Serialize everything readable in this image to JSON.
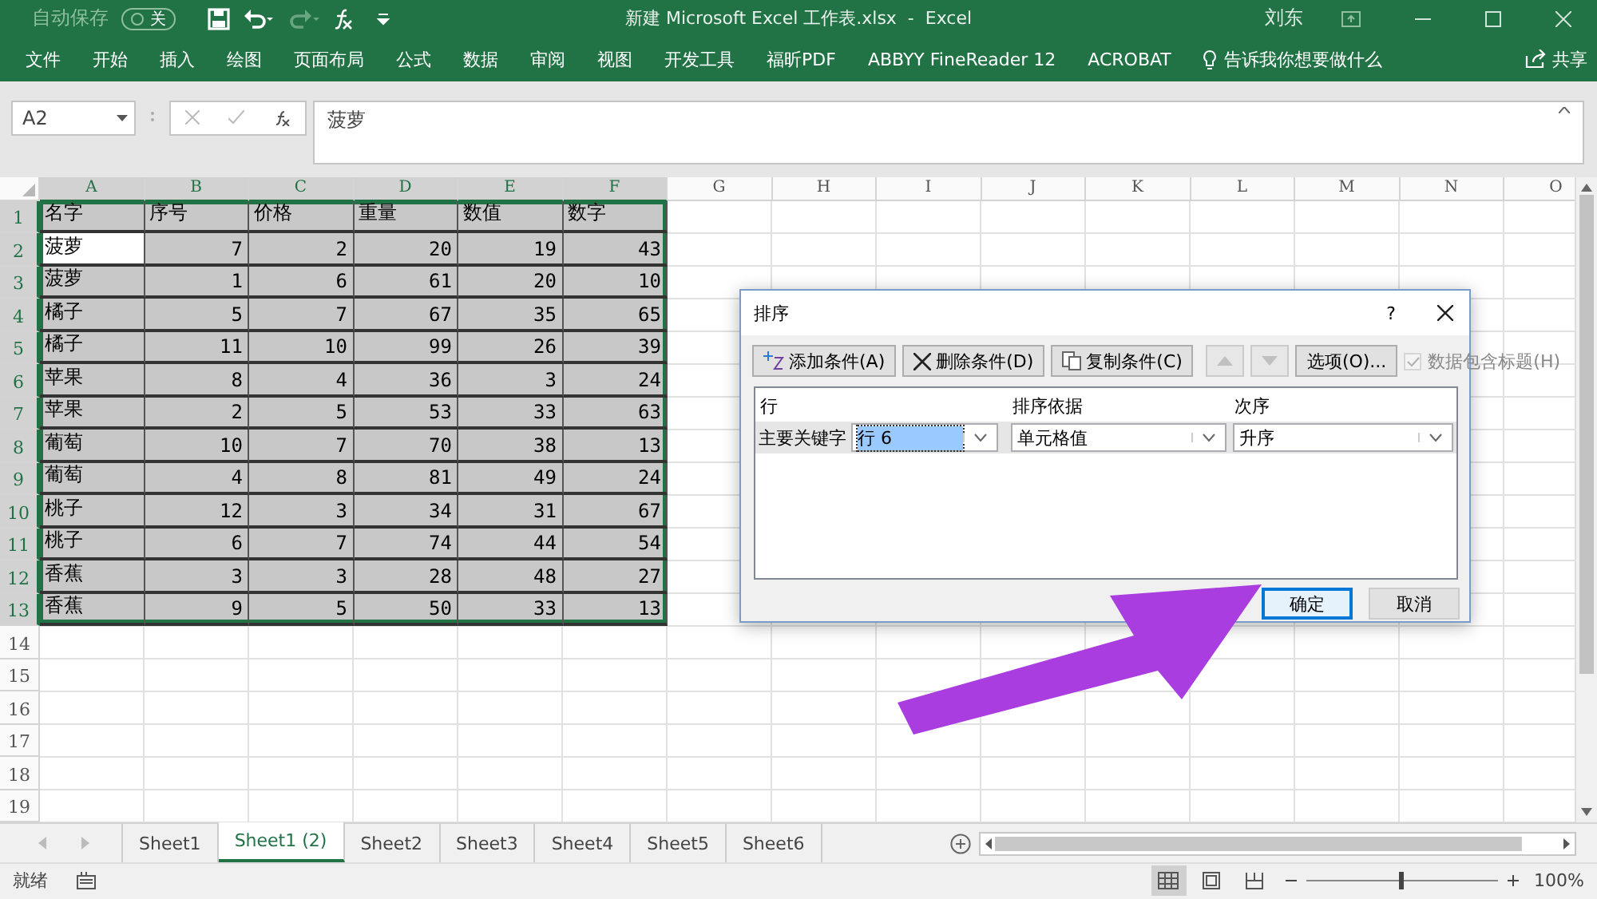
{
  "title_bar": {
    "autosave_label": "自动保存",
    "autosave_state": "关",
    "autosave_on": false,
    "title": "新建 Microsoft Excel 工作表.xlsx  -  Excel",
    "user": "刘东"
  },
  "ribbon": {
    "tabs": [
      "文件",
      "开始",
      "插入",
      "绘图",
      "页面布局",
      "公式",
      "数据",
      "审阅",
      "视图",
      "开发工具",
      "福昕PDF",
      "ABBYY FineReader 12",
      "ACROBAT"
    ],
    "tell_me": "告诉我你想要做什么",
    "share": "共享"
  },
  "formula_bar": {
    "name_box": "A2",
    "formula": "菠萝"
  },
  "sheet": {
    "columns": [
      {
        "label": "A",
        "selected": true
      },
      {
        "label": "B",
        "selected": true
      },
      {
        "label": "C",
        "selected": true
      },
      {
        "label": "D",
        "selected": true
      },
      {
        "label": "E",
        "selected": true
      },
      {
        "label": "F",
        "selected": true
      },
      {
        "label": "G",
        "selected": false
      },
      {
        "label": "H",
        "selected": false
      },
      {
        "label": "I",
        "selected": false
      },
      {
        "label": "J",
        "selected": false
      },
      {
        "label": "K",
        "selected": false
      },
      {
        "label": "L",
        "selected": false
      },
      {
        "label": "M",
        "selected": false
      },
      {
        "label": "N",
        "selected": false
      },
      {
        "label": "O",
        "selected": false
      }
    ],
    "rows": [
      {
        "header": "1",
        "selected": true,
        "cells": [
          "名字",
          "序号",
          "价格",
          "重量",
          "数值",
          "数字"
        ]
      },
      {
        "header": "2",
        "selected": true,
        "cells": [
          {
            "text": "菠萝",
            "active": true
          },
          "7",
          "2",
          "20",
          "19",
          "43"
        ]
      },
      {
        "header": "3",
        "selected": true,
        "cells": [
          "菠萝",
          "1",
          "6",
          "61",
          "20",
          "10"
        ]
      },
      {
        "header": "4",
        "selected": true,
        "cells": [
          "橘子",
          "5",
          "7",
          "67",
          "35",
          "65"
        ]
      },
      {
        "header": "5",
        "selected": true,
        "cells": [
          "橘子",
          "11",
          "10",
          "99",
          "26",
          "39"
        ]
      },
      {
        "header": "6",
        "selected": true,
        "cells": [
          "苹果",
          "8",
          "4",
          "36",
          "3",
          "24"
        ]
      },
      {
        "header": "7",
        "selected": true,
        "cells": [
          "苹果",
          "2",
          "5",
          "53",
          "33",
          "63"
        ]
      },
      {
        "header": "8",
        "selected": true,
        "cells": [
          "葡萄",
          "10",
          "7",
          "70",
          "38",
          "13"
        ]
      },
      {
        "header": "9",
        "selected": true,
        "cells": [
          "葡萄",
          "4",
          "8",
          "81",
          "49",
          "24"
        ]
      },
      {
        "header": "10",
        "selected": true,
        "cells": [
          "桃子",
          "12",
          "3",
          "34",
          "31",
          "67"
        ]
      },
      {
        "header": "11",
        "selected": true,
        "cells": [
          "桃子",
          "6",
          "7",
          "74",
          "44",
          "54"
        ]
      },
      {
        "header": "12",
        "selected": true,
        "cells": [
          "香蕉",
          "3",
          "3",
          "28",
          "48",
          "27"
        ]
      },
      {
        "header": "13",
        "selected": true,
        "cells": [
          "香蕉",
          "9",
          "5",
          "50",
          "33",
          "13"
        ]
      },
      {
        "header": "14",
        "selected": false,
        "cells": []
      },
      {
        "header": "15",
        "selected": false,
        "cells": []
      },
      {
        "header": "16",
        "selected": false,
        "cells": []
      },
      {
        "header": "17",
        "selected": false,
        "cells": []
      },
      {
        "header": "18",
        "selected": false,
        "cells": []
      },
      {
        "header": "19",
        "selected": false,
        "cells": []
      }
    ]
  },
  "sheet_tabs": [
    {
      "label": "Sheet1",
      "selected": false
    },
    {
      "label": "Sheet1 (2)",
      "selected": true
    },
    {
      "label": "Sheet2",
      "selected": false
    },
    {
      "label": "Sheet3",
      "selected": false
    },
    {
      "label": "Sheet4",
      "selected": false
    },
    {
      "label": "Sheet5",
      "selected": false
    },
    {
      "label": "Sheet6",
      "selected": false
    }
  ],
  "status_bar": {
    "status": "就绪",
    "views": [
      {
        "kind": "normal",
        "selected": true
      },
      {
        "kind": "page-layout",
        "selected": false
      },
      {
        "kind": "page-break",
        "selected": false
      }
    ],
    "zoom_slider": {
      "level": 0.5
    },
    "zoom": "100%"
  },
  "sort_dialog": {
    "title": "排序",
    "help": "?",
    "toolbar": [
      {
        "kind": "add",
        "label": "添加条件(A)",
        "disabled": false
      },
      {
        "kind": "delete",
        "label": "删除条件(D)",
        "disabled": false
      },
      {
        "kind": "copy",
        "label": "复制条件(C)",
        "disabled": false
      },
      {
        "kind": "up",
        "disabled": true
      },
      {
        "kind": "down",
        "disabled": true
      },
      {
        "kind": "options",
        "label": "选项(O)...",
        "disabled": false
      }
    ],
    "header_checkbox": {
      "label": "数据包含标题(H)",
      "checked": true,
      "disabled": true
    },
    "columns": [
      "行",
      "排序依据",
      "次序"
    ],
    "levels": [
      {
        "label": "主要关键字",
        "key": "行 6",
        "basis": "单元格值",
        "order": "升序"
      }
    ],
    "buttons": [
      {
        "label": "确定",
        "default": true
      },
      {
        "label": "取消",
        "default": false
      }
    ]
  }
}
